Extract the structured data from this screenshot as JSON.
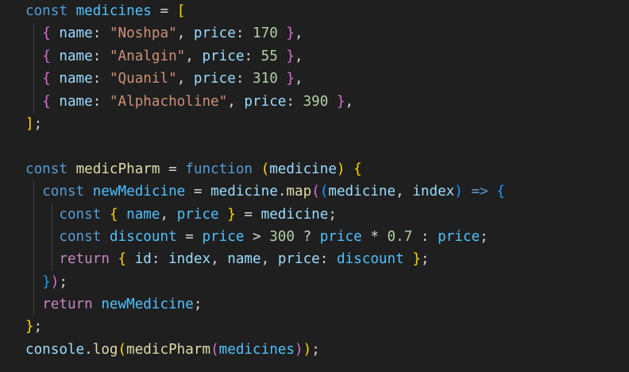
{
  "editor": {
    "theme_colors": {
      "background": "#1f1f1f",
      "keyword": "#569cd6",
      "control_keyword": "#c586c0",
      "variable": "#9cdcfe",
      "constant": "#4fc1ff",
      "function": "#dcdcaa",
      "string": "#ce9178",
      "number": "#b5cea8",
      "bracket_1": "#ffd700",
      "bracket_2": "#da70d6",
      "bracket_3": "#179fff"
    },
    "lines": [
      {
        "indent": 0,
        "tokens": [
          {
            "c": "kw",
            "t": "const"
          },
          {
            "c": "op",
            "t": " "
          },
          {
            "c": "cnst",
            "t": "medicines"
          },
          {
            "c": "op",
            "t": " = "
          },
          {
            "c": "b1",
            "t": "["
          }
        ]
      },
      {
        "indent": 1,
        "tokens": [
          {
            "c": "b2",
            "t": "{"
          },
          {
            "c": "op",
            "t": " "
          },
          {
            "c": "var",
            "t": "name"
          },
          {
            "c": "op",
            "t": ": "
          },
          {
            "c": "str",
            "t": "\"Noshpa\""
          },
          {
            "c": "op",
            "t": ", "
          },
          {
            "c": "var",
            "t": "price"
          },
          {
            "c": "op",
            "t": ": "
          },
          {
            "c": "num",
            "t": "170"
          },
          {
            "c": "op",
            "t": " "
          },
          {
            "c": "b2",
            "t": "}"
          },
          {
            "c": "op",
            "t": ","
          }
        ]
      },
      {
        "indent": 1,
        "tokens": [
          {
            "c": "b2",
            "t": "{"
          },
          {
            "c": "op",
            "t": " "
          },
          {
            "c": "var",
            "t": "name"
          },
          {
            "c": "op",
            "t": ": "
          },
          {
            "c": "str",
            "t": "\"Analgin\""
          },
          {
            "c": "op",
            "t": ", "
          },
          {
            "c": "var",
            "t": "price"
          },
          {
            "c": "op",
            "t": ": "
          },
          {
            "c": "num",
            "t": "55"
          },
          {
            "c": "op",
            "t": " "
          },
          {
            "c": "b2",
            "t": "}"
          },
          {
            "c": "op",
            "t": ","
          }
        ]
      },
      {
        "indent": 1,
        "tokens": [
          {
            "c": "b2",
            "t": "{"
          },
          {
            "c": "op",
            "t": " "
          },
          {
            "c": "var",
            "t": "name"
          },
          {
            "c": "op",
            "t": ": "
          },
          {
            "c": "str",
            "t": "\"Quanil\""
          },
          {
            "c": "op",
            "t": ", "
          },
          {
            "c": "var",
            "t": "price"
          },
          {
            "c": "op",
            "t": ": "
          },
          {
            "c": "num",
            "t": "310"
          },
          {
            "c": "op",
            "t": " "
          },
          {
            "c": "b2",
            "t": "}"
          },
          {
            "c": "op",
            "t": ","
          }
        ]
      },
      {
        "indent": 1,
        "tokens": [
          {
            "c": "b2",
            "t": "{"
          },
          {
            "c": "op",
            "t": " "
          },
          {
            "c": "var",
            "t": "name"
          },
          {
            "c": "op",
            "t": ": "
          },
          {
            "c": "str",
            "t": "\"Alphacholine\""
          },
          {
            "c": "op",
            "t": ", "
          },
          {
            "c": "var",
            "t": "price"
          },
          {
            "c": "op",
            "t": ": "
          },
          {
            "c": "num",
            "t": "390"
          },
          {
            "c": "op",
            "t": " "
          },
          {
            "c": "b2",
            "t": "}"
          },
          {
            "c": "op",
            "t": ","
          }
        ]
      },
      {
        "indent": 0,
        "tokens": [
          {
            "c": "b1",
            "t": "]"
          },
          {
            "c": "op",
            "t": ";"
          }
        ]
      },
      {
        "indent": 0,
        "tokens": []
      },
      {
        "indent": 0,
        "tokens": [
          {
            "c": "kw",
            "t": "const"
          },
          {
            "c": "op",
            "t": " "
          },
          {
            "c": "fn",
            "t": "medicPharm"
          },
          {
            "c": "op",
            "t": " = "
          },
          {
            "c": "kw",
            "t": "function"
          },
          {
            "c": "op",
            "t": " "
          },
          {
            "c": "b1",
            "t": "("
          },
          {
            "c": "var",
            "t": "medicine"
          },
          {
            "c": "b1",
            "t": ")"
          },
          {
            "c": "op",
            "t": " "
          },
          {
            "c": "b1",
            "t": "{"
          }
        ]
      },
      {
        "indent": 1,
        "tokens": [
          {
            "c": "kw",
            "t": "const"
          },
          {
            "c": "op",
            "t": " "
          },
          {
            "c": "cnst",
            "t": "newMedicine"
          },
          {
            "c": "op",
            "t": " = "
          },
          {
            "c": "var",
            "t": "medicine"
          },
          {
            "c": "op",
            "t": "."
          },
          {
            "c": "fn",
            "t": "map"
          },
          {
            "c": "b2",
            "t": "("
          },
          {
            "c": "b3",
            "t": "("
          },
          {
            "c": "var",
            "t": "medicine"
          },
          {
            "c": "op",
            "t": ", "
          },
          {
            "c": "var",
            "t": "index"
          },
          {
            "c": "b3",
            "t": ")"
          },
          {
            "c": "op",
            "t": " "
          },
          {
            "c": "kw",
            "t": "=>"
          },
          {
            "c": "op",
            "t": " "
          },
          {
            "c": "b3",
            "t": "{"
          }
        ]
      },
      {
        "indent": 2,
        "tokens": [
          {
            "c": "kw",
            "t": "const"
          },
          {
            "c": "op",
            "t": " "
          },
          {
            "c": "b1",
            "t": "{"
          },
          {
            "c": "op",
            "t": " "
          },
          {
            "c": "cnst",
            "t": "name"
          },
          {
            "c": "op",
            "t": ", "
          },
          {
            "c": "cnst",
            "t": "price"
          },
          {
            "c": "op",
            "t": " "
          },
          {
            "c": "b1",
            "t": "}"
          },
          {
            "c": "op",
            "t": " = "
          },
          {
            "c": "var",
            "t": "medicine"
          },
          {
            "c": "op",
            "t": ";"
          }
        ]
      },
      {
        "indent": 2,
        "tokens": [
          {
            "c": "kw",
            "t": "const"
          },
          {
            "c": "op",
            "t": " "
          },
          {
            "c": "cnst",
            "t": "discount"
          },
          {
            "c": "op",
            "t": " = "
          },
          {
            "c": "cnst",
            "t": "price"
          },
          {
            "c": "op",
            "t": " > "
          },
          {
            "c": "num",
            "t": "300"
          },
          {
            "c": "op",
            "t": " ? "
          },
          {
            "c": "cnst",
            "t": "price"
          },
          {
            "c": "op",
            "t": " * "
          },
          {
            "c": "num",
            "t": "0.7"
          },
          {
            "c": "op",
            "t": " : "
          },
          {
            "c": "cnst",
            "t": "price"
          },
          {
            "c": "op",
            "t": ";"
          }
        ]
      },
      {
        "indent": 2,
        "tokens": [
          {
            "c": "ret",
            "t": "return"
          },
          {
            "c": "op",
            "t": " "
          },
          {
            "c": "b1",
            "t": "{"
          },
          {
            "c": "op",
            "t": " "
          },
          {
            "c": "var",
            "t": "id"
          },
          {
            "c": "op",
            "t": ": "
          },
          {
            "c": "var",
            "t": "index"
          },
          {
            "c": "op",
            "t": ", "
          },
          {
            "c": "var",
            "t": "name"
          },
          {
            "c": "op",
            "t": ", "
          },
          {
            "c": "var",
            "t": "price"
          },
          {
            "c": "op",
            "t": ": "
          },
          {
            "c": "cnst",
            "t": "discount"
          },
          {
            "c": "op",
            "t": " "
          },
          {
            "c": "b1",
            "t": "}"
          },
          {
            "c": "op",
            "t": ";"
          }
        ]
      },
      {
        "indent": 1,
        "tokens": [
          {
            "c": "b3",
            "t": "}"
          },
          {
            "c": "b2",
            "t": ")"
          },
          {
            "c": "op",
            "t": ";"
          }
        ]
      },
      {
        "indent": 1,
        "tokens": [
          {
            "c": "ret",
            "t": "return"
          },
          {
            "c": "op",
            "t": " "
          },
          {
            "c": "cnst",
            "t": "newMedicine"
          },
          {
            "c": "op",
            "t": ";"
          }
        ]
      },
      {
        "indent": 0,
        "tokens": [
          {
            "c": "b1",
            "t": "}"
          },
          {
            "c": "op",
            "t": ";"
          }
        ]
      },
      {
        "indent": 0,
        "tokens": [
          {
            "c": "var",
            "t": "console"
          },
          {
            "c": "op",
            "t": "."
          },
          {
            "c": "fn",
            "t": "log"
          },
          {
            "c": "b1",
            "t": "("
          },
          {
            "c": "fn",
            "t": "medicPharm"
          },
          {
            "c": "b2",
            "t": "("
          },
          {
            "c": "cnst",
            "t": "medicines"
          },
          {
            "c": "b2",
            "t": ")"
          },
          {
            "c": "b1",
            "t": ")"
          },
          {
            "c": "op",
            "t": ";"
          }
        ]
      }
    ]
  }
}
